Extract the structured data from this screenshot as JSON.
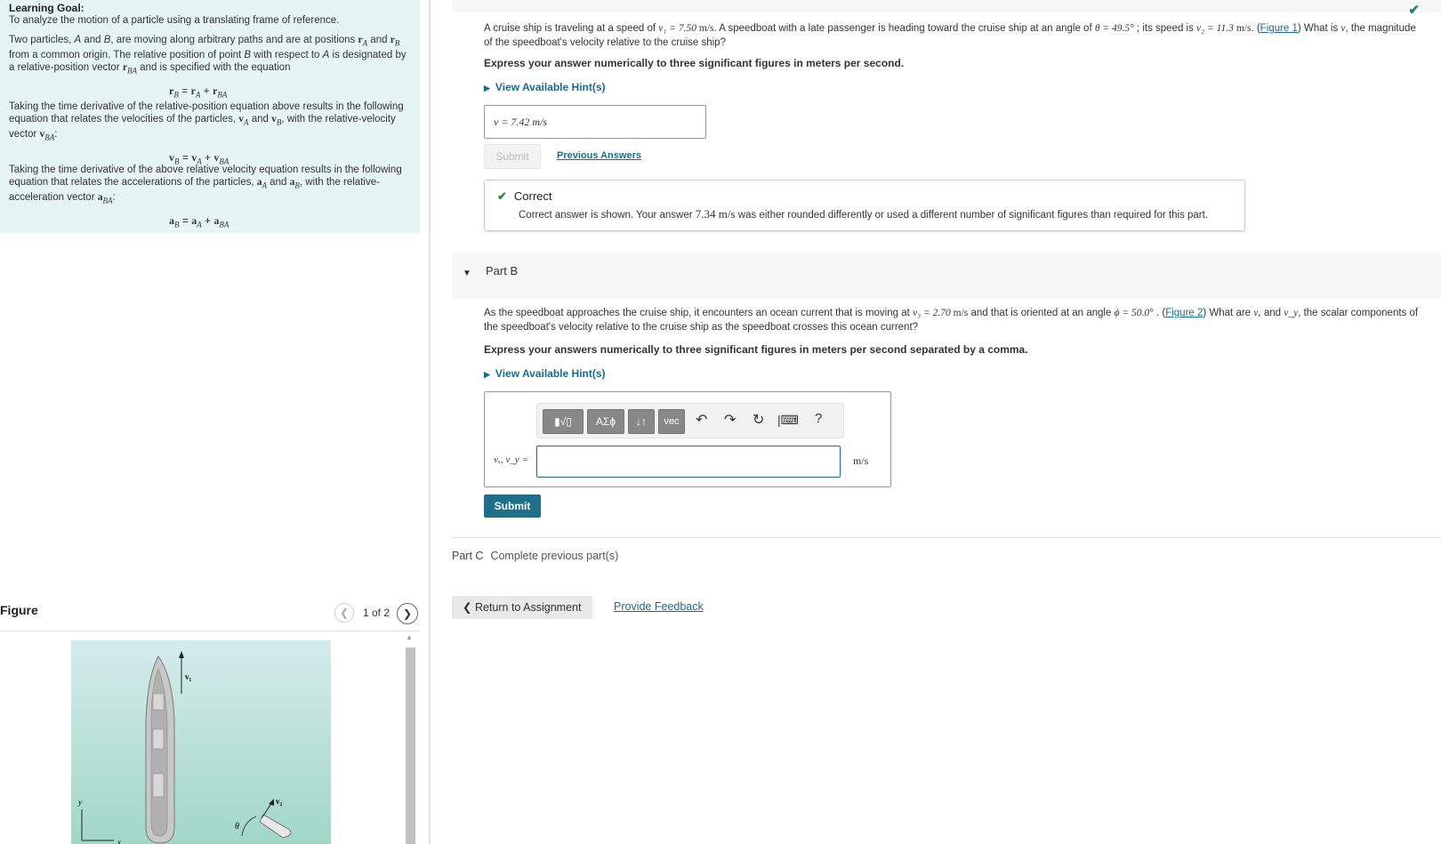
{
  "goal": {
    "heading": "Learning Goal:",
    "intro": "To analyze the motion of a particle using a translating frame of reference.",
    "p1a": "Two particles, ",
    "p1b": "A",
    "p1c": " and ",
    "p1d": "B",
    "p1e": ", are moving along arbitrary paths and are at positions ",
    "p1f": " and ",
    "p1g": " from a common origin. The relative position of point ",
    "p1h": "B",
    "p1i": " with respect to ",
    "p1j": "A",
    "p1k": " is designated by a relative-position vector ",
    "p1l": " and is specified with the equation",
    "p2": "Taking the time derivative of the relative-position equation above results in the following equation that relates the velocities of the particles, ",
    "p2b": " and ",
    "p2c": ", with the relative-velocity vector ",
    "p3": "Taking the time derivative of the above relative velocity equation results in the following equation that relates the accelerations of the particles, ",
    "p3b": " and ",
    "p3c": ", with the relative-acceleration vector "
  },
  "figure": {
    "title": "Figure",
    "counter": "1 of 2",
    "labels": {
      "v1": "v₁",
      "v2": "v₂",
      "theta": "θ",
      "y": "y",
      "x": "x"
    }
  },
  "partA": {
    "q1": "A cruise ship is traveling at a speed of ",
    "q_v1": "v₁ = 7.50 ",
    "q_unit": "m/s",
    "q2": ". A speedboat with a late passenger is heading toward the cruise ship at an angle of ",
    "q_theta": "θ = 49.5°",
    "q3": " ; its speed is ",
    "q_v2": "v₂ = 11.3 ",
    "q4": ". (",
    "fig_link": "Figure 1",
    "q5": ") What is ",
    "q_v": "v",
    "q6": ", the magnitude of the speedboat's velocity relative to the cruise ship?",
    "instruction": "Express your answer numerically to three significant figures in meters per second.",
    "hint": "View Available Hint(s)",
    "answer": "v =  7.42  m/s",
    "submit": "Submit",
    "previous": "Previous Answers",
    "correct_title": "Correct",
    "correct_detail": "Correct answer is shown. Your answer ",
    "correct_value": "7.34 m/s",
    "correct_detail2": " was either rounded differently or used a different number of significant figures than required for this part."
  },
  "partB": {
    "title": "Part B",
    "q1": "As the speedboat approaches the cruise ship, it encounters an ocean current that is moving at ",
    "q_v3": "v₃ = 2.70 ",
    "q_unit": "m/s",
    "q2": " and that is oriented at an angle ",
    "q_phi": "ϕ = 50.0°",
    "q3": " . (",
    "fig_link": "Figure 2",
    "q4": ") What are ",
    "q_vx": "vₓ",
    "q5": " and ",
    "q_vy": "v_y",
    "q6": ", the scalar components of the speedboat's velocity relative to the cruise ship as the speedboat crosses this ocean current?",
    "instruction": "Express your answers numerically to three significant figures in meters per second separated by a comma.",
    "hint": "View Available Hint(s)",
    "toolbar": {
      "templates": "▮√▯",
      "greek": "ΑΣϕ",
      "arrows": "↓↑",
      "vec": "vec",
      "help": "?"
    },
    "label": "vₓ, v_y =",
    "input_value": "",
    "unit": "m/s",
    "submit": "Submit"
  },
  "partC": {
    "label": "Part C",
    "text": "Complete previous part(s)"
  },
  "footer": {
    "return": "Return to Assignment",
    "feedback": "Provide Feedback"
  }
}
